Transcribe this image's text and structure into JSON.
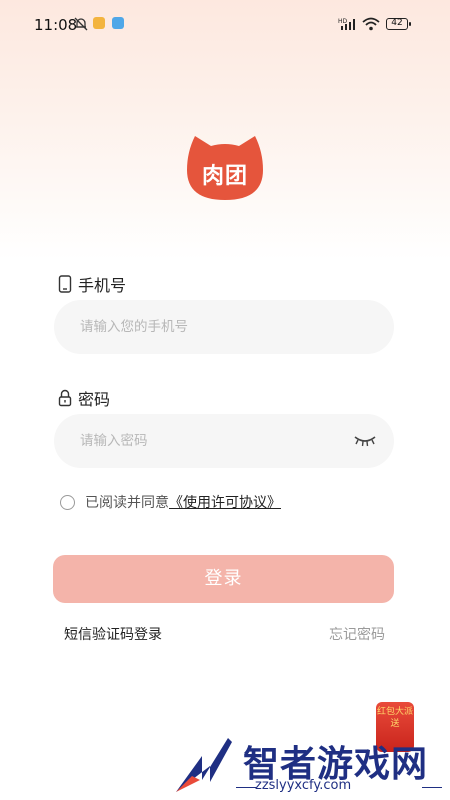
{
  "status_bar": {
    "time": "11:08",
    "network": "HD",
    "battery": "42",
    "icons": [
      "bell-off-icon",
      "notification-app-icon",
      "upload-app-icon",
      "signal-icon",
      "wifi-icon",
      "battery-icon"
    ]
  },
  "app": {
    "logo_text": "肉团",
    "brand_color": "#e5553c"
  },
  "phone": {
    "label": "手机号",
    "placeholder": "请输入您的手机号",
    "value": "",
    "icon": "phone-icon"
  },
  "password": {
    "label": "密码",
    "placeholder": "请输入密码",
    "value": "",
    "icon": "lock-icon",
    "toggle_icon": "eye-closed-icon"
  },
  "agreement": {
    "checked": false,
    "text": "已阅读并同意",
    "link": "《使用许可协议》"
  },
  "login_button": {
    "label": "登录",
    "color": "#f4b4aa"
  },
  "links": {
    "sms_login": "短信验证码登录",
    "forgot_password": "忘记密码"
  },
  "watermark": {
    "promo": "红包大派送",
    "title": "智者游戏网",
    "url": "zzslyyxcfy.com"
  }
}
